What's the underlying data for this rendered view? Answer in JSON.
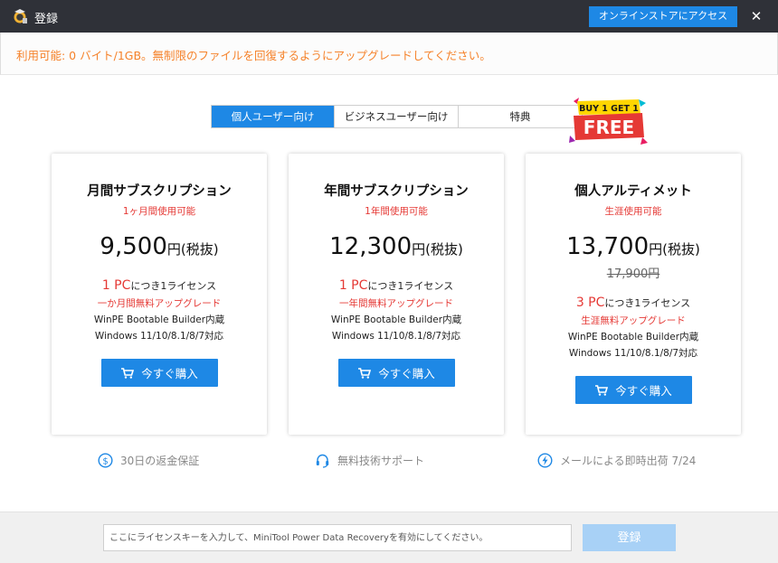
{
  "window": {
    "title": "登録",
    "store_button": "オンラインストアにアクセス",
    "close_glyph": "✕"
  },
  "notice": {
    "text": "利用可能: 0 バイト/1GB。無制限のファイルを回復するようにアップグレードしてください。"
  },
  "tabs": [
    {
      "label": "個人ユーザー向け",
      "active": true
    },
    {
      "label": "ビジネスユーザー向け",
      "active": false
    },
    {
      "label": "特典",
      "active": false
    }
  ],
  "promo": {
    "line1": "BUY 1 GET 1",
    "line2": "FREE"
  },
  "plans": [
    {
      "title": "月間サブスクリプション",
      "subtitle": "1ヶ月間使用可能",
      "price": "9,500",
      "price_unit": "円(税抜)",
      "license_count": "1 PC",
      "license_text": "につき1ライセンス",
      "upgrade": "一か月間無料アップグレード",
      "feature_1": "WinPE Bootable Builder内蔵",
      "feature_2": "Windows 11/10/8.1/8/7対応",
      "buy_label": "今すぐ購入"
    },
    {
      "title": "年間サブスクリプション",
      "subtitle": "1年間使用可能",
      "price": "12,300",
      "price_unit": "円(税抜)",
      "license_count": "1 PC",
      "license_text": "につき1ライセンス",
      "upgrade": "一年間無料アップグレード",
      "feature_1": "WinPE Bootable Builder内蔵",
      "feature_2": "Windows 11/10/8.1/8/7対応",
      "buy_label": "今すぐ購入"
    },
    {
      "title": "個人アルティメット",
      "subtitle": "生涯使用可能",
      "price": "13,700",
      "price_unit": "円(税抜)",
      "old_price": "17,900円",
      "license_count": "3 PC",
      "license_text": "につき1ライセンス",
      "upgrade": "生涯無料アップグレード",
      "feature_1": "WinPE Bootable Builder内蔵",
      "feature_2": "Windows 11/10/8.1/8/7対応",
      "buy_label": "今すぐ購入"
    }
  ],
  "assurances": [
    {
      "icon": "money-back-icon",
      "text": "30日の返金保証"
    },
    {
      "icon": "headset-icon",
      "text": "無料技術サポート"
    },
    {
      "icon": "lightning-icon",
      "text": "メールによる即時出荷 7/24"
    }
  ],
  "footer": {
    "key_placeholder": "ここにライセンスキーを入力して、MiniTool Power Data Recoveryを有効にしてください。",
    "key_value": "",
    "register_label": "登録"
  },
  "colors": {
    "accent": "#1e88e5",
    "warning": "#f5822a",
    "red": "#e53935",
    "titlebar": "#2f3138",
    "register_disabled": "#a8d1f6"
  }
}
